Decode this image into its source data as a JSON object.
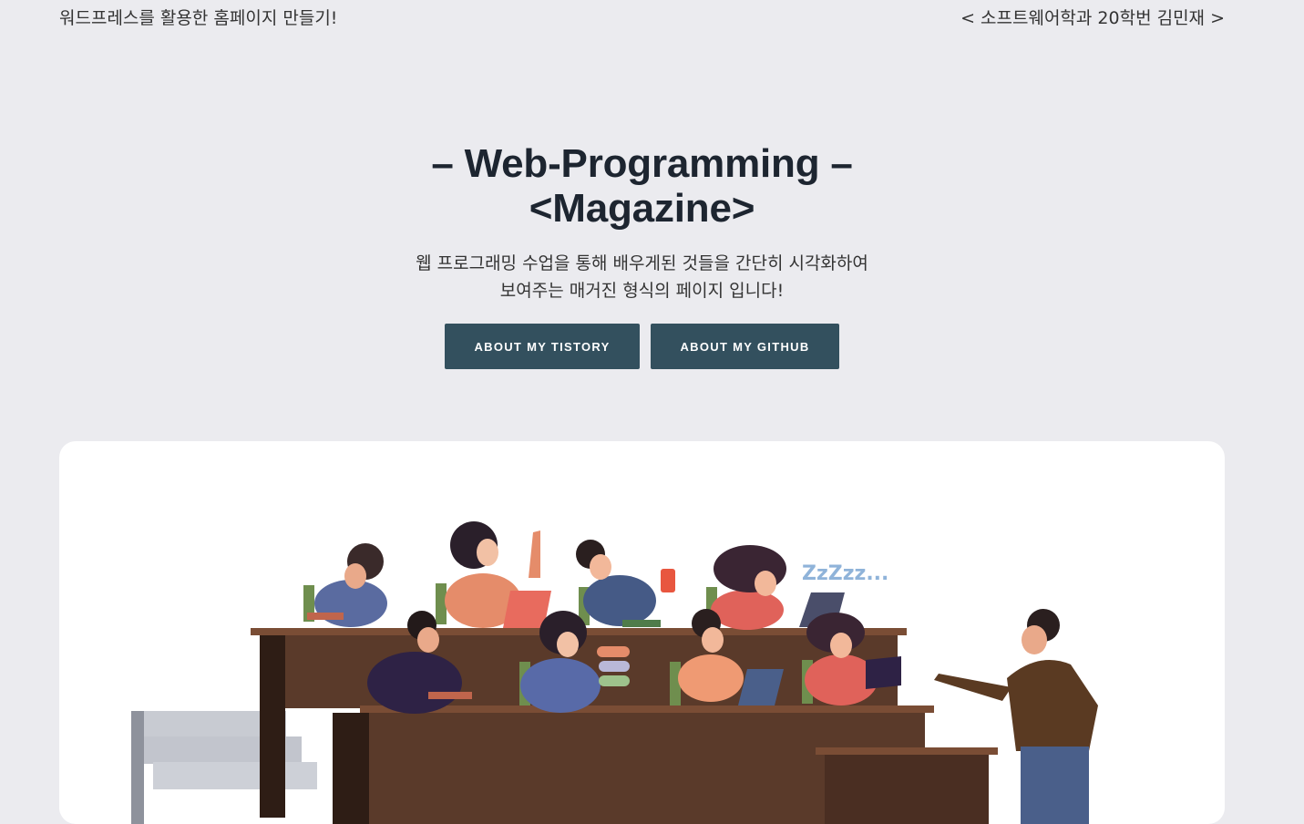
{
  "header": {
    "left_text": "워드프레스를 활용한 홈페이지 만들기!",
    "right_text": "< 소프트웨어학과 20학번 김민재 >"
  },
  "hero": {
    "title_line1": "– Web-Programming –",
    "title_line2": "<Magazine>",
    "subtitle_line1": "웹 프로그래밍 수업을 통해 배우게된 것들을 간단히 시각화하여",
    "subtitle_line2": "보여주는 매거진 형식의 페이지 입니다!"
  },
  "buttons": {
    "tistory_label": "ABOUT MY TISTORY",
    "github_label": "ABOUT MY GITHUB"
  },
  "illustration": {
    "sleep_text": "ZzZzz..."
  },
  "colors": {
    "background": "#ebebef",
    "button": "#33505e",
    "title": "#1d2530",
    "desk": "#5a3a2a"
  }
}
